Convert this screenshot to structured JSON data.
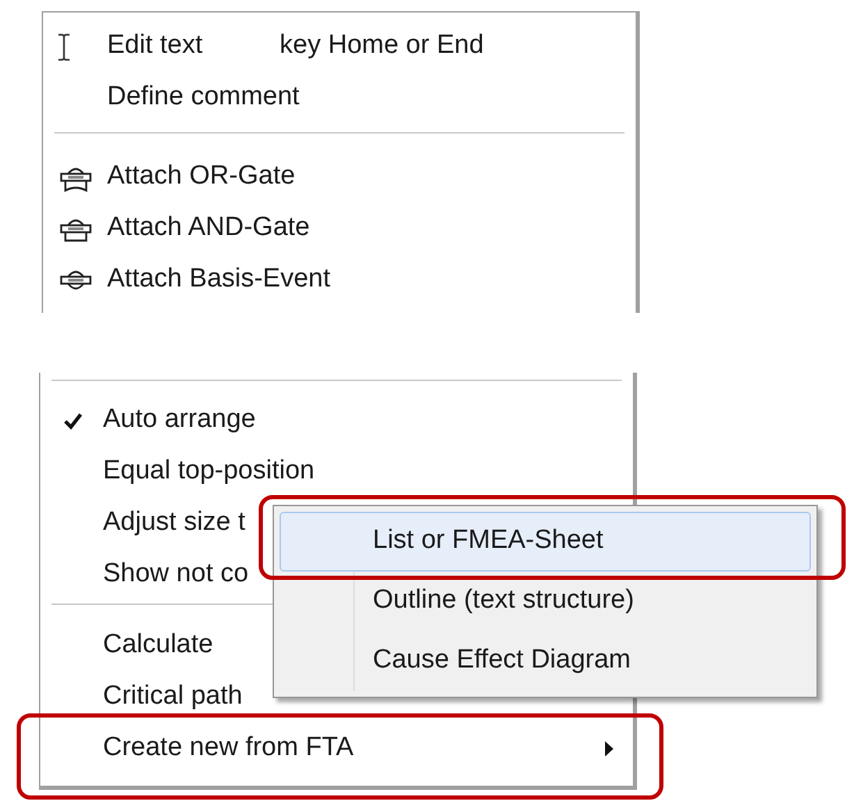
{
  "menus": [
    {
      "items": [
        {
          "kind": "text-item",
          "label": "Edit text",
          "shortcut": "key Home or End"
        },
        {
          "kind": "text-item",
          "label": "Define comment"
        },
        {
          "kind": "separator"
        },
        {
          "kind": "attach-item",
          "label": "Attach OR-Gate"
        },
        {
          "kind": "attach-item",
          "label": "Attach AND-Gate"
        },
        {
          "kind": "attach-item",
          "label": "Attach Basis-Event"
        }
      ]
    },
    {
      "items": [
        {
          "kind": "separator"
        },
        {
          "kind": "check-item",
          "label": "Auto arrange",
          "checked": true
        },
        {
          "kind": "check-item",
          "label": "Equal top-position",
          "checked": false
        },
        {
          "kind": "check-item",
          "label": "Adjust size t",
          "checked": false
        },
        {
          "kind": "check-item",
          "label": "Show not co",
          "checked": false
        },
        {
          "kind": "separator"
        },
        {
          "kind": "text-item",
          "label": "Calculate"
        },
        {
          "kind": "text-item",
          "label": "Critical path"
        },
        {
          "kind": "submenu-item",
          "label": "Create new from FTA"
        }
      ]
    }
  ],
  "submenu": {
    "items": [
      {
        "label": "List or FMEA-Sheet",
        "selected": true
      },
      {
        "label": "Outline (text structure)",
        "selected": false
      },
      {
        "label": "Cause Effect Diagram",
        "selected": false
      }
    ]
  }
}
